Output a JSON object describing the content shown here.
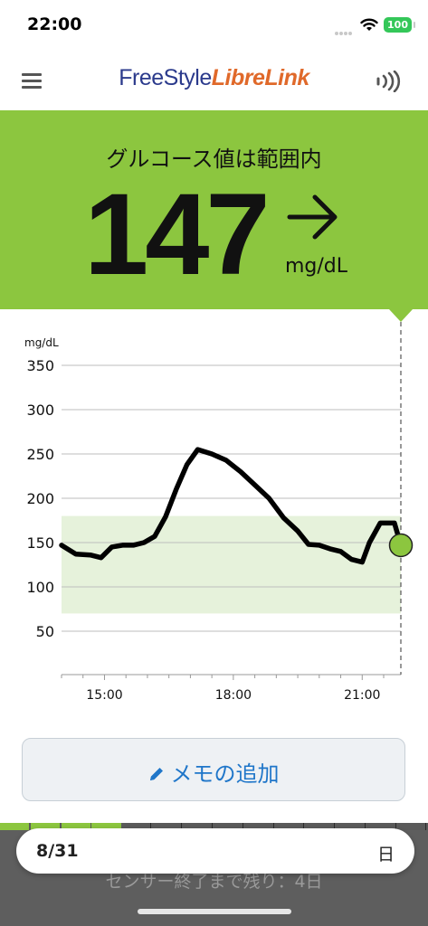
{
  "status_bar": {
    "time": "22:00",
    "battery": "100"
  },
  "header": {
    "brand_free": "FreeStyle",
    "brand_libre": "LibreLink"
  },
  "banner": {
    "title": "グルコース値は範囲内",
    "glucose_value": "147",
    "unit": "mg/dL",
    "trend": "steady",
    "color": "#8cc63f"
  },
  "chart_data": {
    "type": "line",
    "ylabel": "mg/dL",
    "ylim": [
      0,
      350
    ],
    "y_ticks": [
      50,
      100,
      150,
      200,
      250,
      300,
      350
    ],
    "x_ticks": [
      "15:00",
      "18:00",
      "21:00"
    ],
    "target_range": [
      70,
      180
    ],
    "x_hours": [
      14.0,
      14.33,
      14.67,
      14.92,
      15.17,
      15.42,
      15.67,
      15.92,
      16.17,
      16.42,
      16.67,
      16.92,
      17.17,
      17.5,
      17.83,
      18.17,
      18.5,
      18.83,
      19.17,
      19.5,
      19.75,
      20.0,
      20.25,
      20.5,
      20.75,
      21.0,
      21.17,
      21.42,
      21.75,
      21.9
    ],
    "y_values": [
      147,
      137,
      136,
      133,
      145,
      147,
      147,
      150,
      157,
      179,
      210,
      238,
      255,
      250,
      243,
      230,
      215,
      200,
      178,
      163,
      148,
      147,
      143,
      140,
      131,
      128,
      150,
      172,
      172,
      147
    ],
    "current_value": 147,
    "line_color": "#000000",
    "range_color": "#e6f2db",
    "point_color": "#8cc63f"
  },
  "memo_button": {
    "label": "メモの追加",
    "color": "#1f76c9"
  },
  "date_pill": {
    "date": "8/31",
    "period": "日"
  },
  "sensor": {
    "text": "センサー終了まで残り：4日",
    "progress_color": "#8cc63f"
  }
}
